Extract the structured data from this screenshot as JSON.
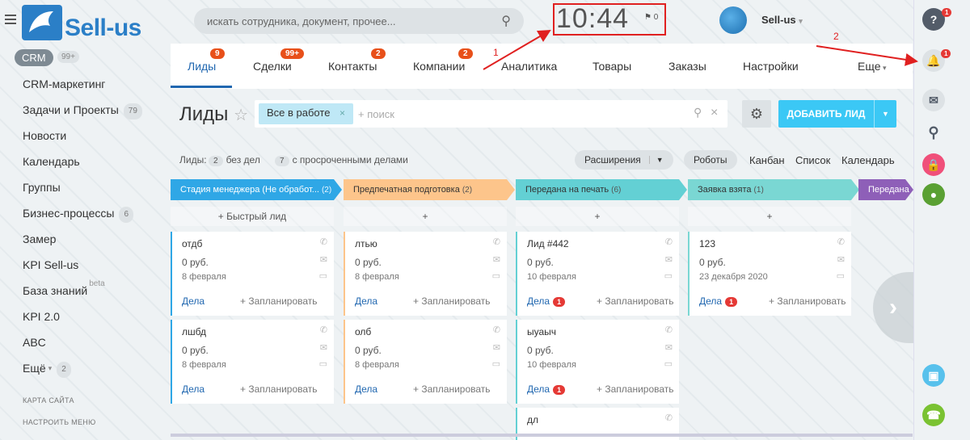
{
  "logo": {
    "text": "Sell-us"
  },
  "header": {
    "search_placeholder": "искать сотрудника, документ, прочее...",
    "clock": "10:44",
    "flag_count": "0",
    "user_name": "Sell-us"
  },
  "sidebar": {
    "crm_label": "CRM",
    "crm_count": "99+",
    "items": [
      {
        "label": "CRM-маркетинг",
        "badge": ""
      },
      {
        "label": "Задачи и Проекты",
        "badge": "79"
      },
      {
        "label": "Новости",
        "badge": ""
      },
      {
        "label": "Календарь",
        "badge": ""
      },
      {
        "label": "Группы",
        "badge": ""
      },
      {
        "label": "Бизнес-процессы",
        "badge": "6"
      },
      {
        "label": "Замер",
        "badge": ""
      },
      {
        "label": "KPI Sell-us",
        "badge": ""
      },
      {
        "label": "База знаний",
        "badge": ""
      },
      {
        "label": "KPI 2.0",
        "badge": ""
      },
      {
        "label": "ABC",
        "badge": ""
      },
      {
        "label": "Ещё",
        "badge": "2"
      }
    ],
    "beta": "beta",
    "sitemap": "КАРТА САЙТА",
    "configure": "НАСТРОИТЬ МЕНЮ"
  },
  "tabs": [
    {
      "label": "Лиды",
      "badge": "9"
    },
    {
      "label": "Сделки",
      "badge": "99+"
    },
    {
      "label": "Контакты",
      "badge": "2"
    },
    {
      "label": "Компании",
      "badge": "2"
    },
    {
      "label": "Аналитика",
      "badge": ""
    },
    {
      "label": "Товары",
      "badge": ""
    },
    {
      "label": "Заказы",
      "badge": ""
    },
    {
      "label": "Настройки",
      "badge": ""
    },
    {
      "label": "Еще",
      "badge": ""
    }
  ],
  "toolbar": {
    "title": "Лиды",
    "filter_tag": "Все в работе",
    "search_placeholder": "+ поиск",
    "add_button": "ДОБАВИТЬ ЛИД"
  },
  "stats": {
    "label": "Лиды:",
    "no_tasks_count": "2",
    "no_tasks_label": "без дел",
    "overdue_count": "7",
    "overdue_label": "с просроченными делами",
    "extensions": "Расширения",
    "robots": "Роботы",
    "views": [
      "Канбан",
      "Список",
      "Календарь"
    ]
  },
  "stages": [
    {
      "name": "Стадия менеджера (Не обработ...",
      "count": "(2)",
      "color": "#2fa7e6",
      "add": "+ Быстрый лид"
    },
    {
      "name": "Предпечатная подготовка",
      "count": "(2)",
      "color": "#fdc58b",
      "add": "+"
    },
    {
      "name": "Передана на печать",
      "count": "(6)",
      "color": "#63d0d4",
      "add": "+"
    },
    {
      "name": "Заявка взята",
      "count": "(1)",
      "color": "#7ad7d3",
      "add": "+"
    },
    {
      "name": "Передана",
      "count": "",
      "color": "#8e5fb8",
      "add": ""
    }
  ],
  "cards": [
    {
      "col": 0,
      "title": "отдб",
      "price": "0 руб.",
      "date": "8 февраля",
      "tasks": "Дела",
      "badge": "",
      "plan": "+ Запланировать"
    },
    {
      "col": 0,
      "title": "лшбд",
      "price": "0 руб.",
      "date": "8 февраля",
      "tasks": "Дела",
      "badge": "",
      "plan": "+ Запланировать"
    },
    {
      "col": 1,
      "title": "лтью",
      "price": "0 руб.",
      "date": "8 февраля",
      "tasks": "Дела",
      "badge": "",
      "plan": "+ Запланировать"
    },
    {
      "col": 1,
      "title": "олб",
      "price": "0 руб.",
      "date": "8 февраля",
      "tasks": "Дела",
      "badge": "",
      "plan": "+ Запланировать"
    },
    {
      "col": 2,
      "title": "Лид #442",
      "price": "0 руб.",
      "date": "10 февраля",
      "tasks": "Дела",
      "badge": "1",
      "plan": "+ Запланировать"
    },
    {
      "col": 2,
      "title": "ыуаыч",
      "price": "0 руб.",
      "date": "10 февраля",
      "tasks": "Дела",
      "badge": "1",
      "plan": "+ Запланировать"
    },
    {
      "col": 2,
      "title": "дл",
      "price": "",
      "date": "",
      "tasks": "",
      "badge": "",
      "plan": ""
    },
    {
      "col": 3,
      "title": "123",
      "price": "0 руб.",
      "date": "23 декабря 2020",
      "tasks": "Дела",
      "badge": "1",
      "plan": "+ Запланировать"
    }
  ],
  "right_panel": {
    "help_badge": "1",
    "bell_badge": "1"
  },
  "annotations": {
    "one": "1",
    "two": "2"
  }
}
